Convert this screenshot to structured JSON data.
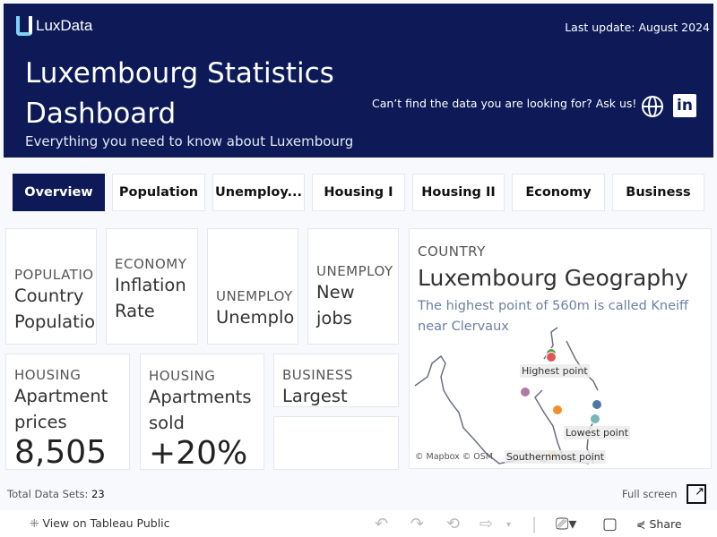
{
  "header": {
    "logo": "LuxData",
    "last_update": "Last update: August 2024",
    "title": "Luxembourg Statistics Dashboard",
    "subtitle": "Everything you need to know about Luxembourg",
    "ask": "Can’t find the data you are looking for? Ask us!",
    "linkedin": "in"
  },
  "tabs": [
    {
      "label": "Overview",
      "active": true
    },
    {
      "label": "Population"
    },
    {
      "label": "Unemploy..."
    },
    {
      "label": "Housing I"
    },
    {
      "label": "Housing II"
    },
    {
      "label": "Economy"
    },
    {
      "label": "Business"
    }
  ],
  "cards": [
    {
      "category": "POPULATIO",
      "title": "Country Populatio"
    },
    {
      "category": "ECONOMY",
      "title": "Inflation Rate"
    },
    {
      "category": "UNEMPLOY",
      "title": "Unemplo"
    },
    {
      "category": "UNEMPLOY",
      "title": "New jobs"
    },
    {
      "category": "HOUSING",
      "title": "Apartment prices",
      "value": "8,505"
    },
    {
      "category": "HOUSING",
      "title": "Apartments sold",
      "value": "+20%"
    },
    {
      "category": "BUSINESS",
      "title": "Largest"
    }
  ],
  "map": {
    "category": "COUNTRY",
    "title": "Luxembourg Geography",
    "description": "The highest point of 560m is called Kneiff near Clervaux",
    "labels": {
      "highest": "Highest point",
      "lowest": "Lowest point",
      "southern": "Southernmost point"
    },
    "attribution": "© Mapbox  © OSM",
    "point_colors": [
      "#59a14f",
      "#e15759",
      "#b07aa1",
      "#f28e2b",
      "#4e79a7",
      "#76b7b2",
      "#edc948"
    ]
  },
  "footer": {
    "total_label": "Total Data Sets:",
    "total_value": "23",
    "full_screen": "Full screen"
  },
  "toolbar": {
    "view_public": "View on Tableau Public",
    "share": "Share"
  }
}
